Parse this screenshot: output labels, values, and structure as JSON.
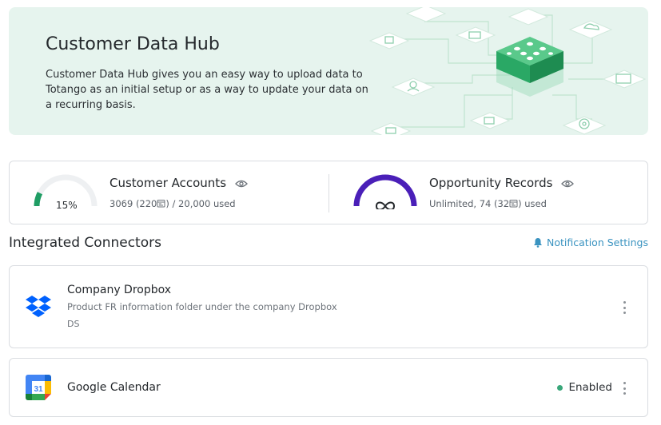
{
  "hero": {
    "title": "Customer Data Hub",
    "description": "Customer Data Hub gives you an easy way to upload data to Totango as an initial setup or as a way to update your data on a recurring basis."
  },
  "usage": {
    "accounts": {
      "title": "Customer Accounts",
      "percent_label": "15%",
      "percent_value": 15,
      "used": "3069",
      "paren": "(220",
      "paren_close": ")",
      "limit": "/ 20,000 used",
      "gauge_color": "#1f9d64"
    },
    "opportunities": {
      "title": "Opportunity Records",
      "prefix": "Unlimited, 74",
      "paren": "(32",
      "paren_close": ")",
      "suffix": "used",
      "gauge_color": "#4a1fb8"
    }
  },
  "connectors": {
    "section_title": "Integrated Connectors",
    "notification_label": "Notification Settings",
    "items": [
      {
        "name": "Company Dropbox",
        "description": "Product FR information folder under the company Dropbox",
        "owner": "DS",
        "icon": "dropbox-icon"
      },
      {
        "name": "Google Calendar",
        "status": "Enabled",
        "calendar_day": "31",
        "icon": "google-calendar-icon"
      }
    ]
  },
  "colors": {
    "hero_bg": "#e6f4ee",
    "link": "#3a93c0",
    "enabled": "#3aa77a"
  }
}
